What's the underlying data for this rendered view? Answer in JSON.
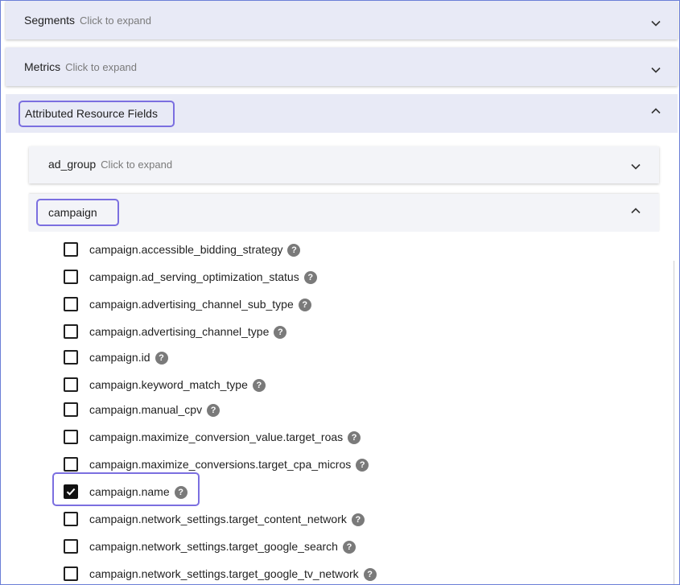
{
  "panels": {
    "segments": {
      "title": "Segments",
      "hint": "Click to expand"
    },
    "metrics": {
      "title": "Metrics",
      "hint": "Click to expand"
    },
    "attributed": {
      "title": "Attributed Resource Fields"
    }
  },
  "subpanels": {
    "ad_group": {
      "title": "ad_group",
      "hint": "Click to expand"
    },
    "campaign": {
      "title": "campaign"
    }
  },
  "fields": [
    {
      "label": "campaign.accessible_bidding_strategy",
      "checked": false
    },
    {
      "label": "campaign.ad_serving_optimization_status",
      "checked": false
    },
    {
      "label": "campaign.advertising_channel_sub_type",
      "checked": false
    },
    {
      "label": "campaign.advertising_channel_type",
      "checked": false
    },
    {
      "label": "campaign.id",
      "checked": false
    },
    {
      "label": "campaign.keyword_match_type",
      "checked": false
    },
    {
      "label": "campaign.manual_cpv",
      "checked": false
    },
    {
      "label": "campaign.maximize_conversion_value.target_roas",
      "checked": false
    },
    {
      "label": "campaign.maximize_conversions.target_cpa_micros",
      "checked": false
    },
    {
      "label": "campaign.name",
      "checked": true
    },
    {
      "label": "campaign.network_settings.target_content_network",
      "checked": false
    },
    {
      "label": "campaign.network_settings.target_google_search",
      "checked": false
    },
    {
      "label": "campaign.network_settings.target_google_tv_network",
      "checked": false
    }
  ],
  "help_glyph": "?",
  "colors": {
    "panel_bg": "#e8eaf6",
    "highlight": "#7b6fe0"
  }
}
